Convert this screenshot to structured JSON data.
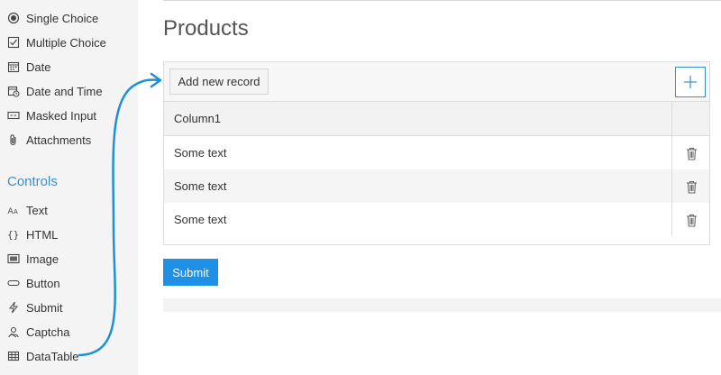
{
  "sidebar": {
    "items": [
      {
        "label": "Single Choice",
        "icon": "radio-icon"
      },
      {
        "label": "Multiple Choice",
        "icon": "checkbox-icon"
      },
      {
        "label": "Date",
        "icon": "calendar-icon"
      },
      {
        "label": "Date and Time",
        "icon": "calendar-clock-icon"
      },
      {
        "label": "Masked Input",
        "icon": "masked-input-icon"
      },
      {
        "label": "Attachments",
        "icon": "paperclip-icon"
      }
    ],
    "controls_heading": "Controls",
    "controls": [
      {
        "label": "Text",
        "icon": "text-icon"
      },
      {
        "label": "HTML",
        "icon": "braces-icon"
      },
      {
        "label": "Image",
        "icon": "image-icon"
      },
      {
        "label": "Button",
        "icon": "button-icon"
      },
      {
        "label": "Submit",
        "icon": "lightning-icon"
      },
      {
        "label": "Captcha",
        "icon": "captcha-icon"
      },
      {
        "label": "DataTable",
        "icon": "table-icon"
      }
    ]
  },
  "main": {
    "title": "Products",
    "toolbar": {
      "add_label": "Add new record",
      "plus_icon": "plus-icon"
    },
    "table": {
      "columns": [
        "Column1"
      ],
      "rows": [
        [
          "Some text"
        ],
        [
          "Some text"
        ],
        [
          "Some text"
        ]
      ],
      "delete_icon": "trash-icon"
    },
    "submit_label": "Submit"
  },
  "colors": {
    "accent": "#3a8fd1",
    "submit": "#1e90e6",
    "sidebar_bg": "#f4f4f4"
  }
}
